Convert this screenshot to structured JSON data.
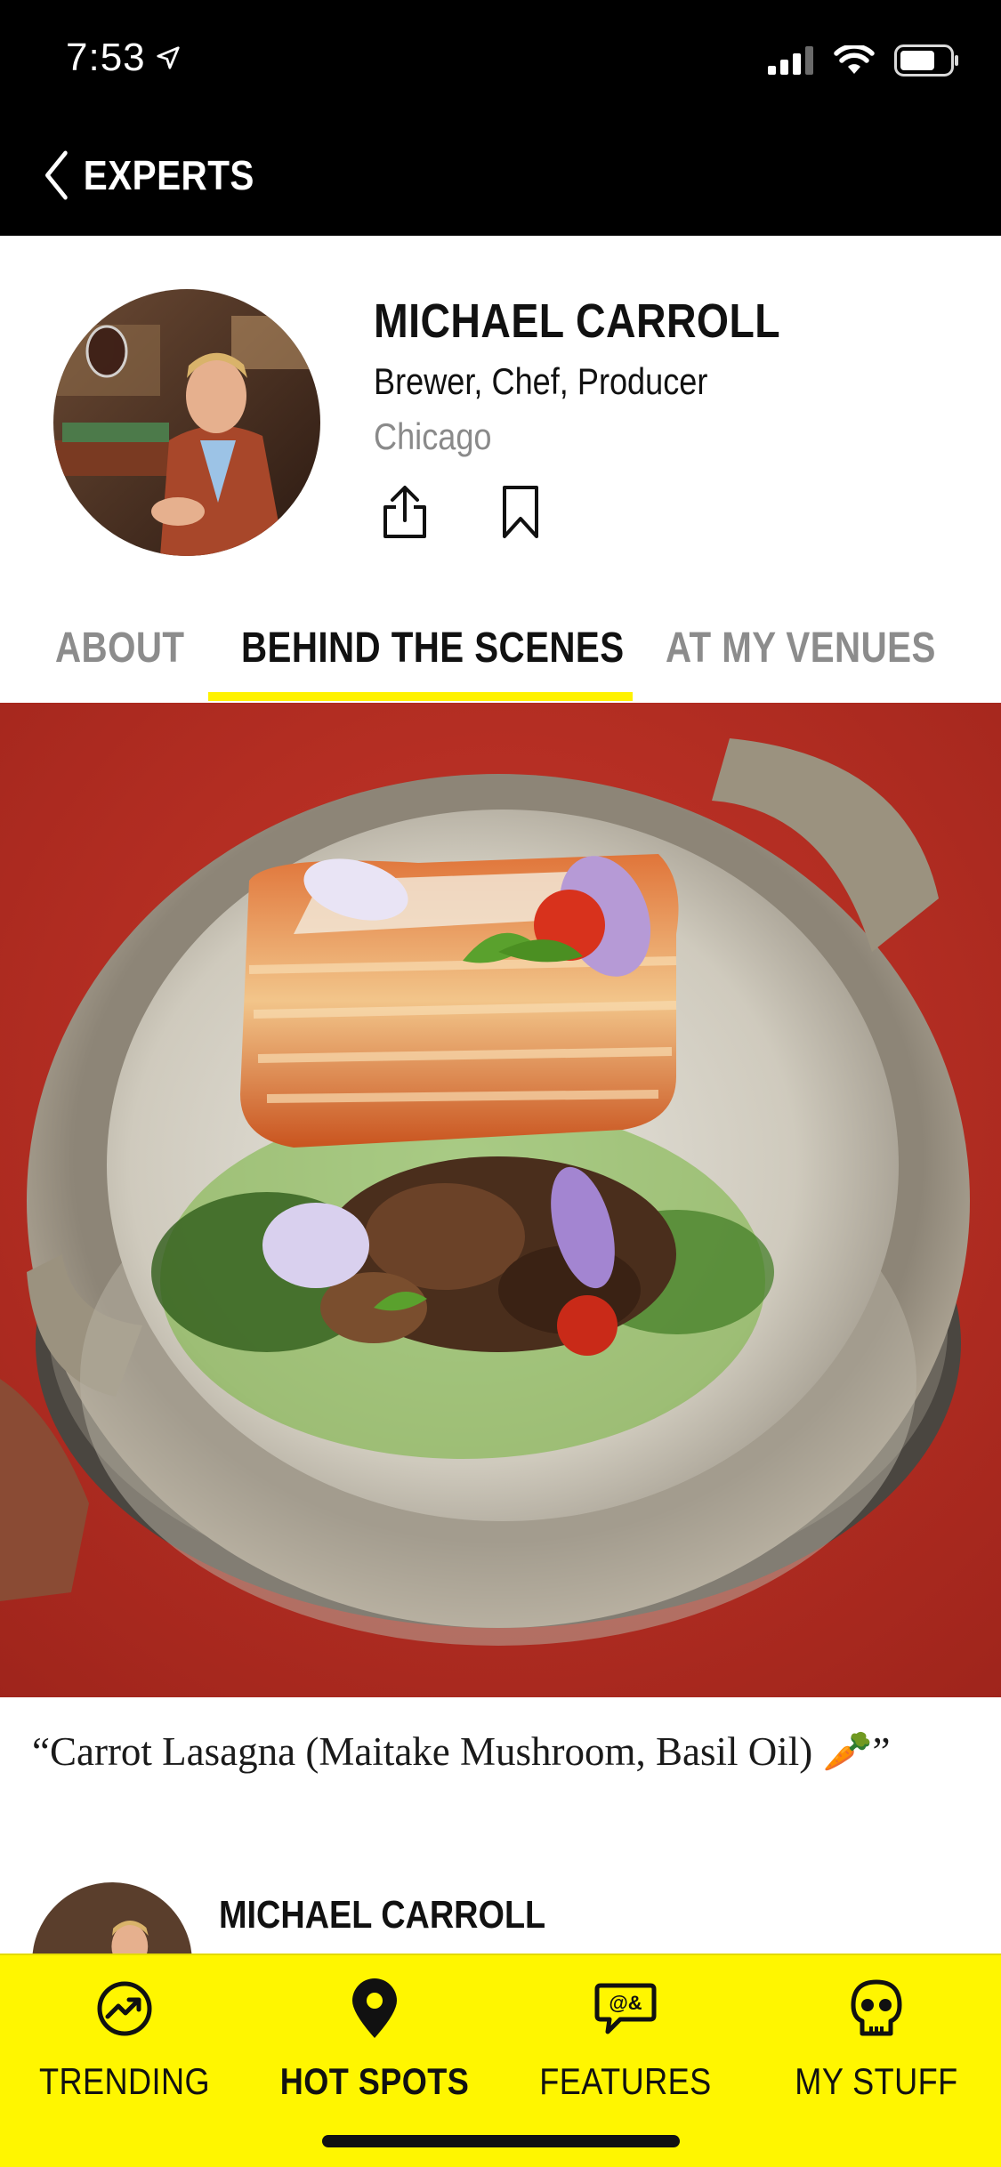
{
  "status_bar": {
    "time": "7:53",
    "icons": [
      "location-arrow-icon",
      "cellular-signal-icon",
      "wifi-icon",
      "battery-icon"
    ]
  },
  "nav": {
    "back_label": "EXPERTS",
    "back_icon": "chevron-left-icon"
  },
  "profile": {
    "name": "MICHAEL CARROLL",
    "roles": "Brewer, Chef, Producer",
    "city": "Chicago",
    "actions": [
      "share-icon",
      "bookmark-icon"
    ]
  },
  "tabs": [
    {
      "label": "ABOUT",
      "active": false
    },
    {
      "label": "BEHIND THE SCENES",
      "active": true
    },
    {
      "label": "AT MY VENUES",
      "active": false
    }
  ],
  "post": {
    "caption": "“Carrot Lasagna (Maitake Mushroom, Basil Oil) 🥕”",
    "author_name": "MICHAEL CARROLL"
  },
  "bottom_tabs": [
    {
      "label": "TRENDING",
      "icon": "trending-icon",
      "active": false
    },
    {
      "label": "HOT SPOTS",
      "icon": "map-pin-icon",
      "active": true
    },
    {
      "label": "FEATURES",
      "icon": "chat-bubble-icon",
      "active": false
    },
    {
      "label": "MY STUFF",
      "icon": "skull-icon",
      "active": false
    }
  ],
  "colors": {
    "accent_yellow": "#fff600",
    "header_black": "#000000",
    "inactive_gray": "#8c8c8c"
  }
}
